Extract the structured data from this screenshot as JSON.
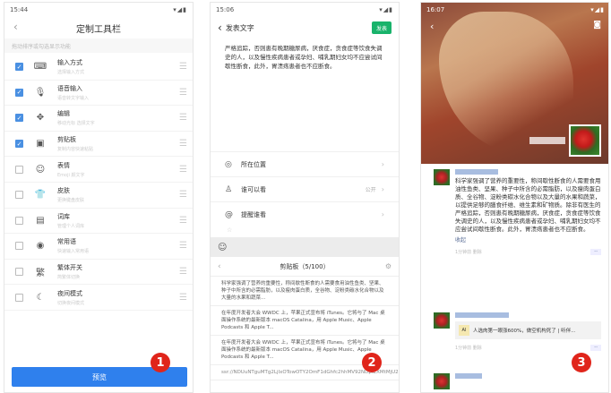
{
  "phone1": {
    "status_time": "15:44",
    "status_icons": "▾◢▮",
    "title": "定制工具栏",
    "hint": "拖动排序或勾选显示功能",
    "tools": [
      {
        "checked": true,
        "icon": "keyboard-icon",
        "glyph": "⌨",
        "name": "输入方式",
        "desc": "选择输入方式"
      },
      {
        "checked": true,
        "icon": "mic-icon",
        "glyph": "🎙",
        "name": "语音输入",
        "desc": "语音转文字输入"
      },
      {
        "checked": true,
        "icon": "cursor-icon",
        "glyph": "✥",
        "name": "编辑",
        "desc": "移动光标 选择文字"
      },
      {
        "checked": true,
        "icon": "clipboard-icon",
        "glyph": "▣",
        "name": "剪贴板",
        "desc": "复制内容快速粘贴"
      },
      {
        "checked": false,
        "icon": "emoji-icon",
        "glyph": "☺",
        "name": "表情",
        "desc": "Emoji 颜文字"
      },
      {
        "checked": false,
        "icon": "skin-icon",
        "glyph": "👕",
        "name": "皮肤",
        "desc": "更换键盘皮肤"
      },
      {
        "checked": false,
        "icon": "dictionary-icon",
        "glyph": "▤",
        "name": "词库",
        "desc": "管理个人词库"
      },
      {
        "checked": false,
        "icon": "phrases-icon",
        "glyph": "◉",
        "name": "常用语",
        "desc": "快速输入常用语"
      },
      {
        "checked": false,
        "icon": "traditional-icon",
        "glyph": "繁",
        "name": "繁体开关",
        "desc": "简繁体切换"
      },
      {
        "checked": false,
        "icon": "moon-icon",
        "glyph": "☾",
        "name": "夜间模式",
        "desc": "切换夜间模式"
      }
    ],
    "preview_label": "预览",
    "badge": "1"
  },
  "phone2": {
    "status_time": "15:06",
    "status_icons": "▾◢▮",
    "title": "发表文字",
    "send_label": "发表",
    "body": "严格追踪，否则患有晚期糖尿病，厌食症，贪食症等饮食失调史的人，以及慢性疾病患者或孕妇、哺乳期妇女均不应尝试间歇性断食，此外，胃溃疡患者也不应断食。",
    "options": [
      {
        "icon": "location-icon",
        "glyph": "◎",
        "label": "所在位置",
        "value": ""
      },
      {
        "icon": "user-icon",
        "glyph": "♙",
        "label": "谁可以看",
        "value": "公开"
      },
      {
        "icon": "at-icon",
        "glyph": "@",
        "label": "提醒谁看",
        "value": ""
      }
    ],
    "star": "☆",
    "emoji_glyph": "☺",
    "clipboard_title": "剪贴板（5/100）",
    "clips": [
      "科学家强调了营养的重要性，称间歇性断食的人需要食用油性鱼类、坚果、种子中所含的必需脂肪，以及瘦肉蛋白质，全谷物、淀粉类碳水化合物以及大量的水果和蔬菜...",
      "在年度开发者大会 WWDC 上，苹果正式宣布将 iTunes。它将与了 Mac 桌面操作系统的最新版本 macOS Catalina，用 Apple Music、Apple Podcasts 和 Apple T...",
      "在年度开发者大会 WWDC 上，苹果正式宣布将 iTunes。它将与了 Mac 桌面操作系统的最新版本 macOS Catalina，用 Apple Music、Apple Podcasts 和 Apple T...",
      "ssr://NDUuNTguMTg2LjIxOTowOTY2OmF1dGhfc2hhMV92NDpiZXMtMjU2LWNmYjoodHBsX3NpbXBsZTpkMZ..."
    ],
    "badge": "2"
  },
  "phone3": {
    "status_time": "16:07",
    "status_icons": "▾◢▮",
    "post1": {
      "text": "科学家强调了营养的重要性，称间歇性断食的人需要食用油性鱼类、坚果、种子中所含的必需脂肪，以及瘦肉蛋白质、全谷物、淀粉类碳水化合物以及大量的水果和蔬菜，以提供足够的膳食纤维、维生素和矿物质。除非有医生的严格追踪，否则患有晚期糖尿病，厌食症，贪食症等饮食失调史的人，以及慢性疾病患者或孕妇、哺乳期妇女均不应尝试间歇性断食。此外，胃溃疡患者也不应断食。",
      "collapse": "收起",
      "time": "1分钟前  删除",
      "more": "··"
    },
    "post2": {
      "share_thumb": "AI",
      "share_text": "人选肉第一眼涨600%，做空机构死了 | 听伴...",
      "time": "1分钟前  删除",
      "more": "··"
    },
    "badge": "3"
  }
}
